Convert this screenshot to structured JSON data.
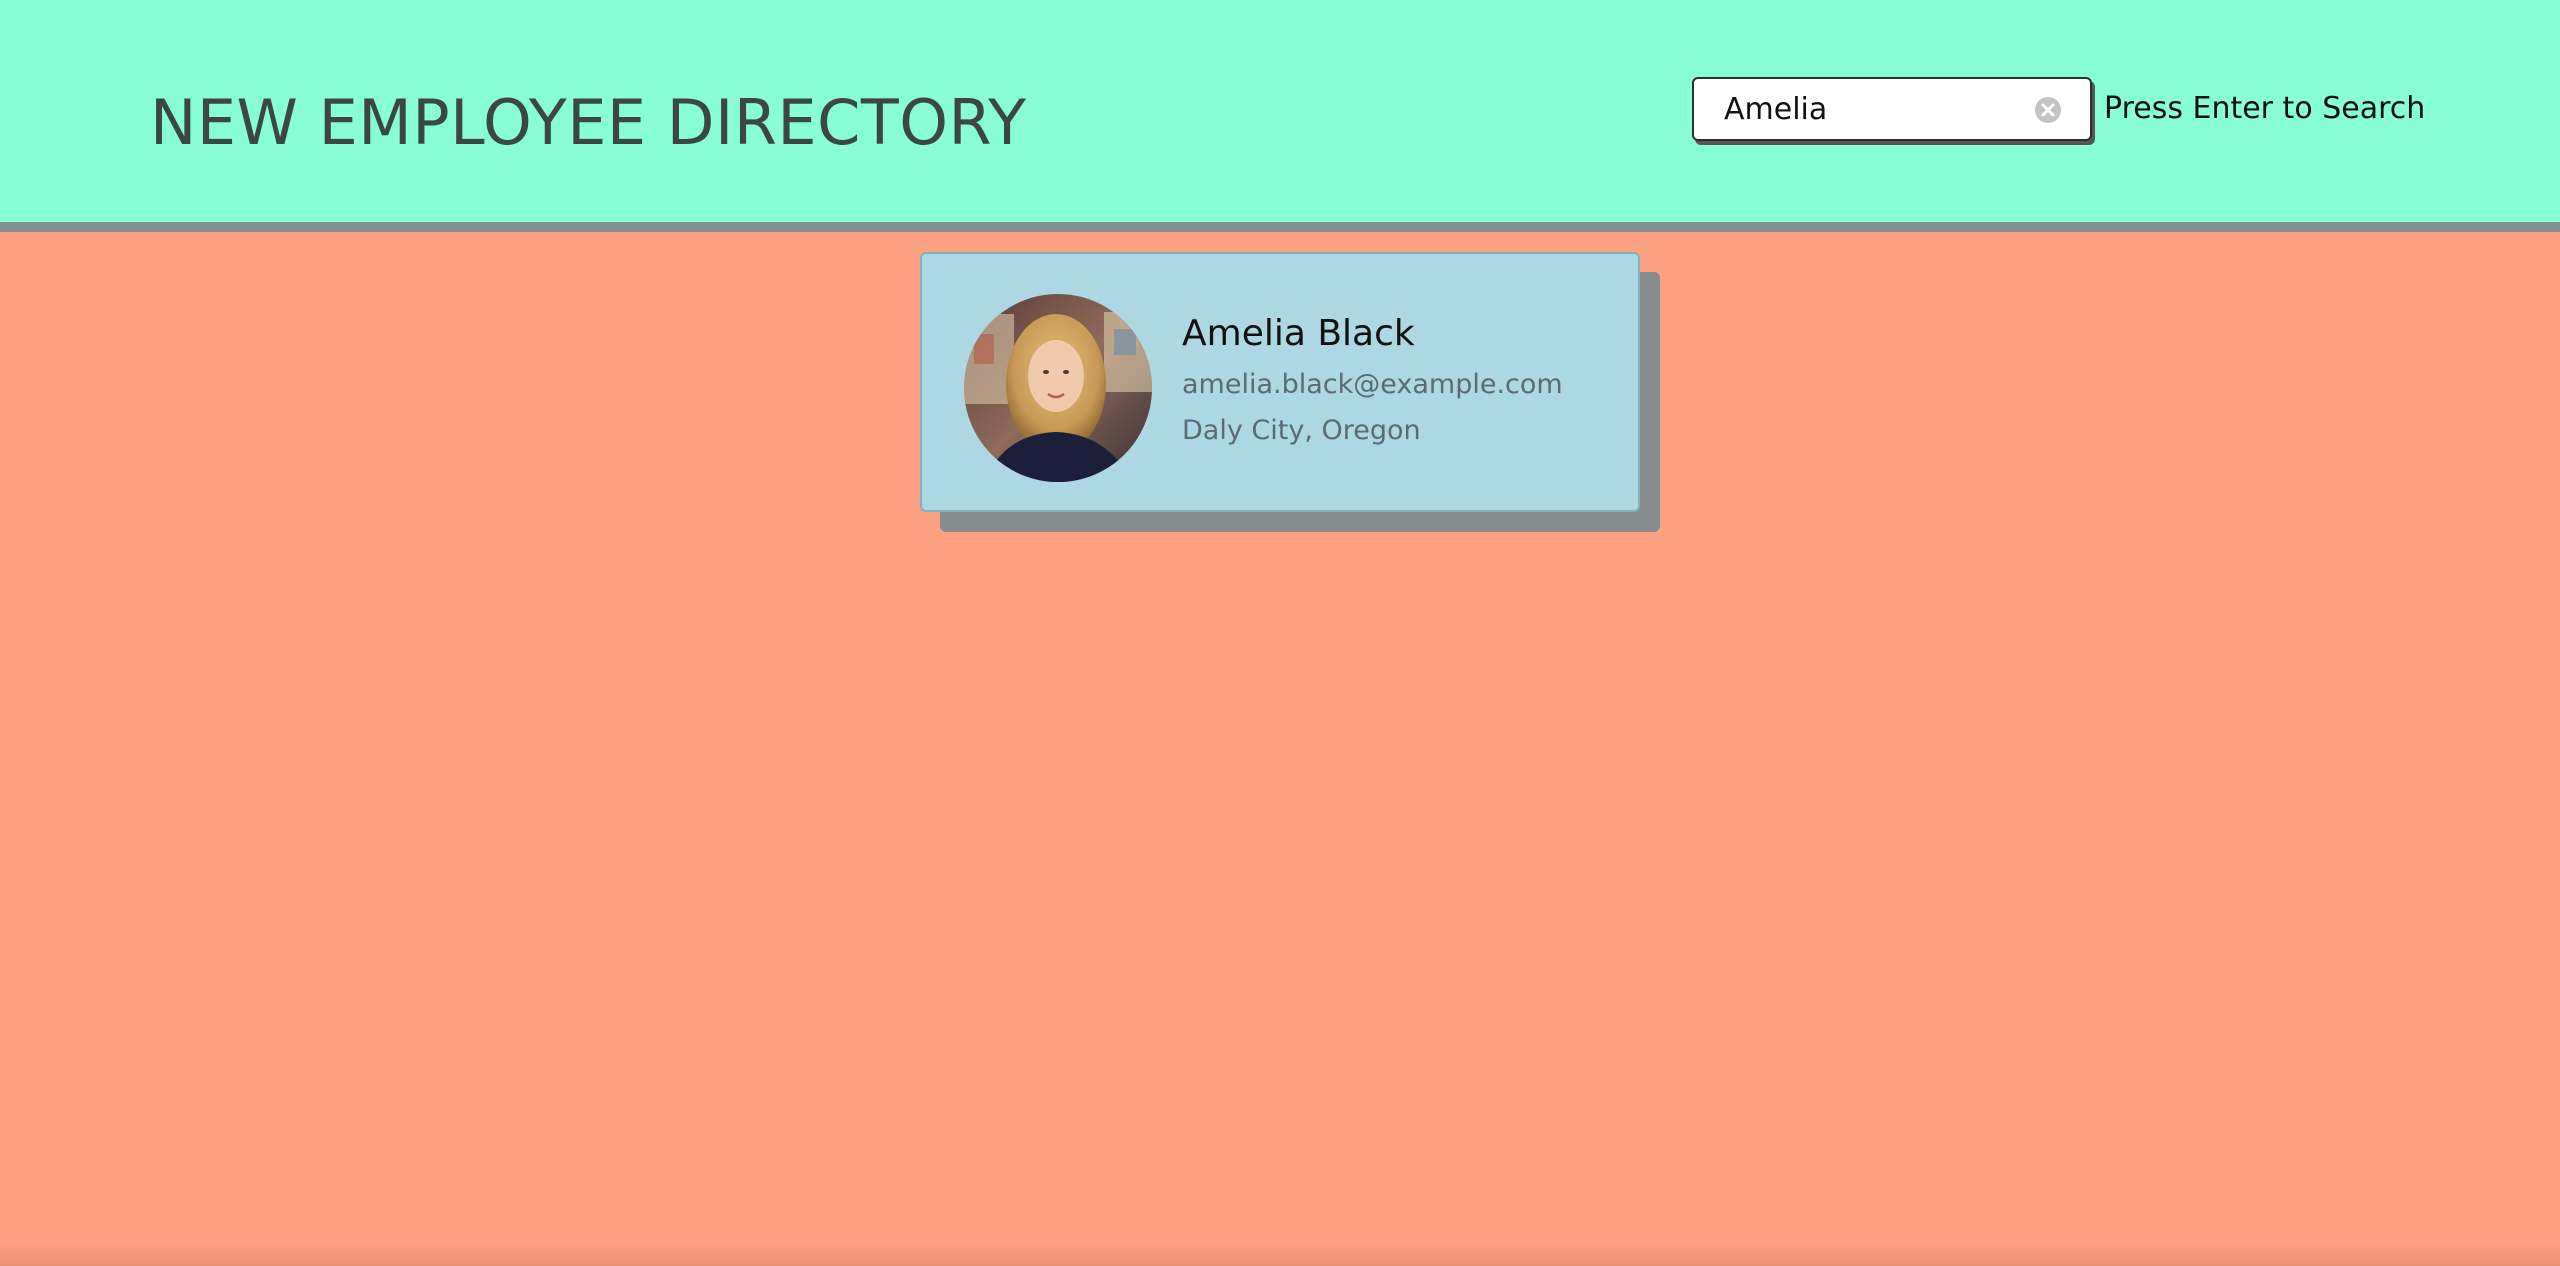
{
  "header": {
    "title": "NEW EMPLOYEE DIRECTORY",
    "background_color": "#87fed6"
  },
  "search": {
    "value": "Amelia",
    "placeholder": "",
    "hint": "Press Enter to Search",
    "clear_icon": "clear-circle-icon"
  },
  "results": {
    "background_color": "#fca182",
    "employees": [
      {
        "name": "Amelia Black",
        "email": "amelia.black@example.com",
        "location": "Daly City, Oregon",
        "card_color": "#aed7e4"
      }
    ]
  }
}
